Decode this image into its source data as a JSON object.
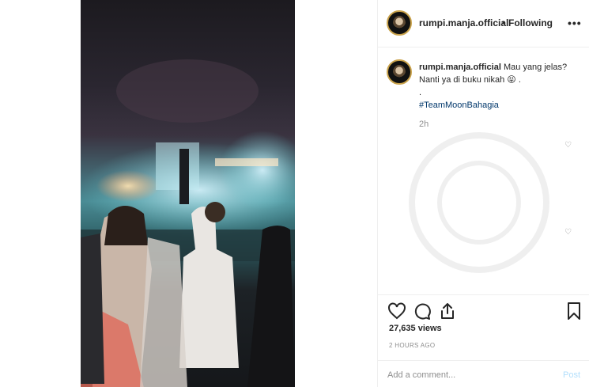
{
  "header": {
    "username": "rumpi.manja.official",
    "separator": "•",
    "follow_status": "Following",
    "more_label": "•••"
  },
  "caption": {
    "username": "rumpi.manja.official",
    "line1": "Mau yang jelas?",
    "line2": "Nanti ya di buku nikah",
    "emoji": "😝",
    "line2_end": ".",
    "dot_line": ".",
    "hashtag": "#TeamMoonBahagia",
    "time": "2h"
  },
  "stats": {
    "views": "27,635 views",
    "posted_ago": "2 HOURS AGO"
  },
  "comment_box": {
    "placeholder": "Add a comment...",
    "post_label": "Post"
  },
  "icons": {
    "like": "heart-icon",
    "comment": "comment-icon",
    "share": "share-icon",
    "save": "bookmark-icon",
    "more": "more-options-icon"
  },
  "colors": {
    "link": "#00376b",
    "muted": "#8e8e8e",
    "post_disabled": "#b2dffc",
    "divider": "#efefef"
  }
}
